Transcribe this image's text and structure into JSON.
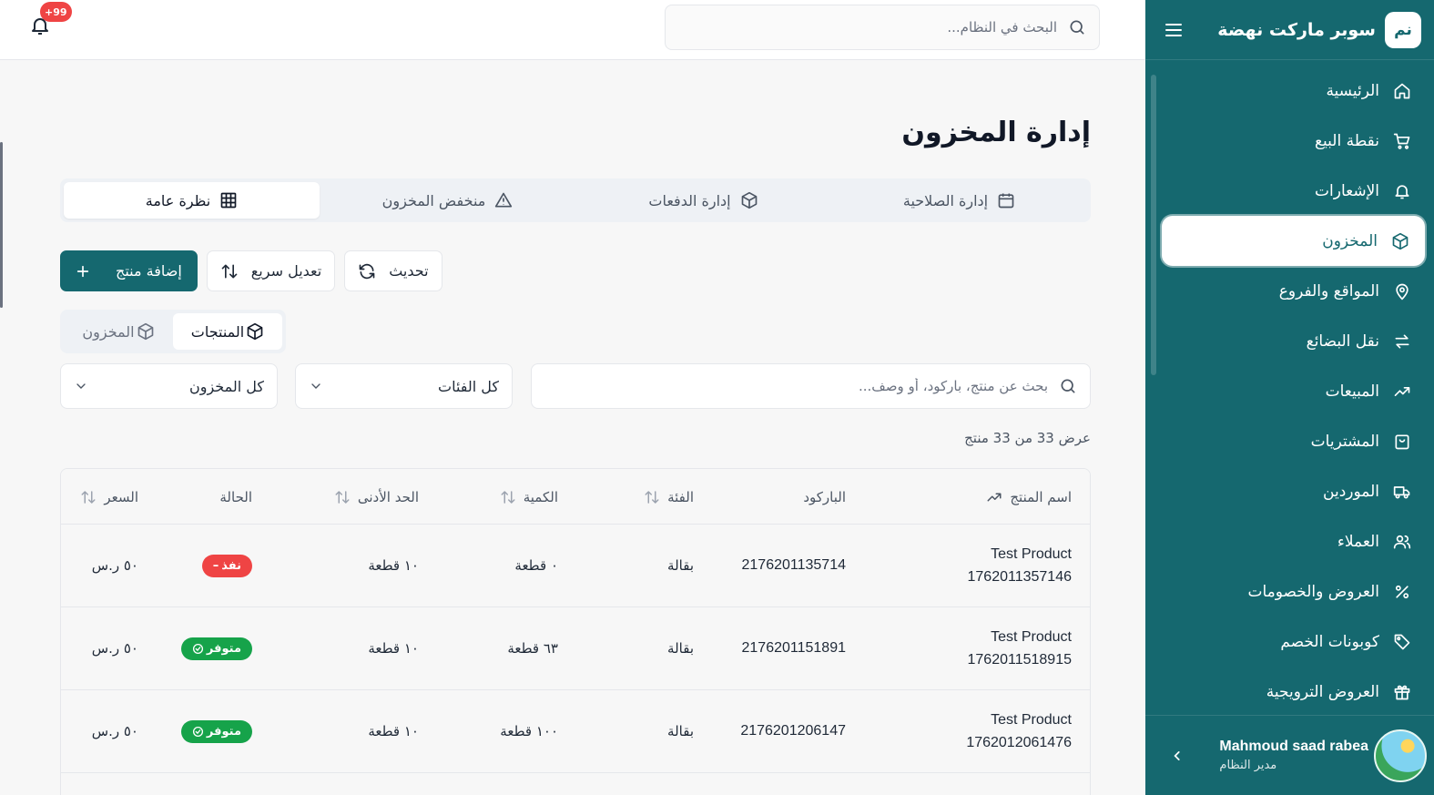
{
  "sidebar": {
    "brand_badge": "نم",
    "brand_name": "سوبر ماركت نهضة",
    "items": [
      {
        "label": "الرئيسية",
        "icon": "home-icon"
      },
      {
        "label": "نقطة البيع",
        "icon": "cart-icon"
      },
      {
        "label": "الإشعارات",
        "icon": "bell-icon"
      },
      {
        "label": "المخزون",
        "icon": "box-icon"
      },
      {
        "label": "المواقع والفروع",
        "icon": "map-pin-icon"
      },
      {
        "label": "نقل البضائع",
        "icon": "transfer-icon"
      },
      {
        "label": "المبيعات",
        "icon": "trending-up-icon"
      },
      {
        "label": "المشتريات",
        "icon": "shopping-bag-icon"
      },
      {
        "label": "الموردين",
        "icon": "truck-icon"
      },
      {
        "label": "العملاء",
        "icon": "users-icon"
      },
      {
        "label": "العروض والخصومات",
        "icon": "percent-icon"
      },
      {
        "label": "كوبونات الخصم",
        "icon": "tag-icon"
      },
      {
        "label": "العروض الترويجية",
        "icon": "gift-icon"
      }
    ],
    "active_index": 3,
    "user": {
      "name": "Mahmoud saad rabea",
      "role": "مدير النظام"
    }
  },
  "topbar": {
    "search_placeholder": "البحث في النظام...",
    "notification_count": "+99"
  },
  "page": {
    "title": "إدارة المخزون",
    "tabs": [
      {
        "label": "إدارة الصلاحية",
        "icon": "calendar-icon"
      },
      {
        "label": "إدارة الدفعات",
        "icon": "package-icon"
      },
      {
        "label": "منخفض المخزون",
        "icon": "alert-triangle-icon"
      },
      {
        "label": "نظرة عامة",
        "icon": "grid-icon"
      }
    ],
    "active_tab": 3,
    "actions": {
      "refresh": "تحديث",
      "quick_edit": "تعديل سريع",
      "add_product": "إضافة منتج"
    },
    "view_toggle": {
      "products": "المنتجات",
      "inventory": "المخزون",
      "active": "products"
    },
    "filters": {
      "search_placeholder": "بحث عن منتج، باركود، أو وصف...",
      "category_selected": "كل الفئات",
      "stock_selected": "كل المخزون"
    },
    "count_text": "عرض 33 من 33 منتج"
  },
  "table": {
    "columns": [
      "اسم المنتج",
      "الباركود",
      "الفئة",
      "الكمية",
      "الحد الأدنى",
      "الحالة",
      "السعر"
    ],
    "rows": [
      {
        "name_line1": "Test Product",
        "name_line2": "1762011357146",
        "barcode": "2176201135714",
        "category": "بقالة",
        "quantity": "٠ قطعة",
        "min": "١٠ قطعة",
        "status": "نفذ",
        "status_type": "out",
        "price": "٥٠ ر.س"
      },
      {
        "name_line1": "Test Product",
        "name_line2": "1762011518915",
        "barcode": "2176201151891",
        "category": "بقالة",
        "quantity": "٦٣ قطعة",
        "min": "١٠ قطعة",
        "status": "متوفر",
        "status_type": "ok",
        "price": "٥٠ ر.س"
      },
      {
        "name_line1": "Test Product",
        "name_line2": "1762012061476",
        "barcode": "2176201206147",
        "category": "بقالة",
        "quantity": "١٠٠ قطعة",
        "min": "١٠ قطعة",
        "status": "متوفر",
        "status_type": "ok",
        "price": "٥٠ ر.س"
      }
    ]
  },
  "colors": {
    "primary": "#15686f",
    "danger": "#ef4444",
    "success": "#16a34a"
  }
}
